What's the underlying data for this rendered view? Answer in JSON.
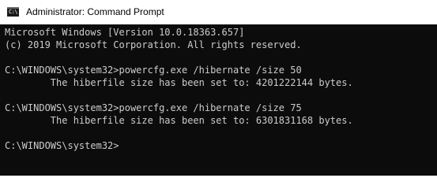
{
  "window": {
    "title": "Administrator: Command Prompt",
    "icon": "cmd-icon",
    "icon_glyph": "C:\\",
    "colors": {
      "console_bg": "#0c0c0c",
      "console_text": "#cccccc",
      "titlebar_bg": "#ffffff"
    }
  },
  "console": {
    "lines": [
      "Microsoft Windows [Version 10.0.18363.657]",
      "(c) 2019 Microsoft Corporation. All rights reserved.",
      "",
      "C:\\WINDOWS\\system32>powercfg.exe /hibernate /size 50",
      "        The hiberfile size has been set to: 4201222144 bytes.",
      "",
      "C:\\WINDOWS\\system32>powercfg.exe /hibernate /size 75",
      "        The hiberfile size has been set to: 6301831168 bytes.",
      "",
      "C:\\WINDOWS\\system32>"
    ]
  }
}
